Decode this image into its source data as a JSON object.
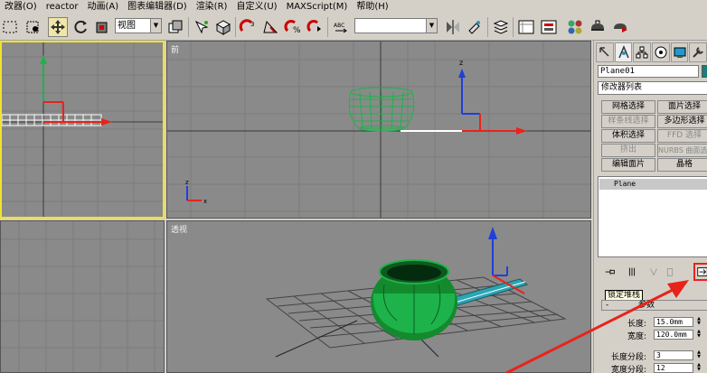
{
  "menubar": {
    "items": [
      "改器(O)",
      "reactor",
      "动画(A)",
      "图表编辑器(D)",
      "渲染(R)",
      "自定义(U)",
      "MAXScript(M)",
      "帮助(H)"
    ]
  },
  "toolbar": {
    "view_dropdown": "视图",
    "abc_label": "ABC",
    "selection_set_dropdown": ""
  },
  "viewports": {
    "top_right_label": "前",
    "bottom_right_label": "透视",
    "axis_x": "x",
    "axis_y": "y",
    "axis_z": "z"
  },
  "command_panel": {
    "object_name": "Plane01",
    "object_color": "#1b7e7a",
    "modifier_list": "修改器列表",
    "buttons": [
      {
        "label": "网格选择",
        "state": "enabled"
      },
      {
        "label": "面片选择",
        "state": "enabled"
      },
      {
        "label": "样条线选择",
        "state": "disabled"
      },
      {
        "label": "多边形选择",
        "state": "enabled"
      },
      {
        "label": "体积选择",
        "state": "enabled"
      },
      {
        "label": "FFD 选择",
        "state": "disabled"
      },
      {
        "label": "挤出",
        "state": "disabled"
      },
      {
        "label": "NURBS 曲面选择",
        "state": "disabled"
      },
      {
        "label": "编辑面片",
        "state": "enabled"
      },
      {
        "label": "晶格",
        "state": "enabled"
      }
    ],
    "stack_item": "Plane",
    "tooltip": "锁定堆栈",
    "rollout_minus": "-",
    "rollout_title": "参数",
    "params": {
      "length_label": "长度:",
      "length_value": "15.0mm",
      "width_label": "宽度:",
      "width_value": "120.0mm",
      "length_segs_label": "长度分段:",
      "length_segs_value": "3",
      "width_segs_label": "宽度分段:",
      "width_segs_value": "12"
    }
  },
  "colors": {
    "viewport_bg": "#8a8a8a",
    "active_border": "#f2e32a",
    "object_green": "#1db34a",
    "annotation_red": "#e8231b"
  }
}
